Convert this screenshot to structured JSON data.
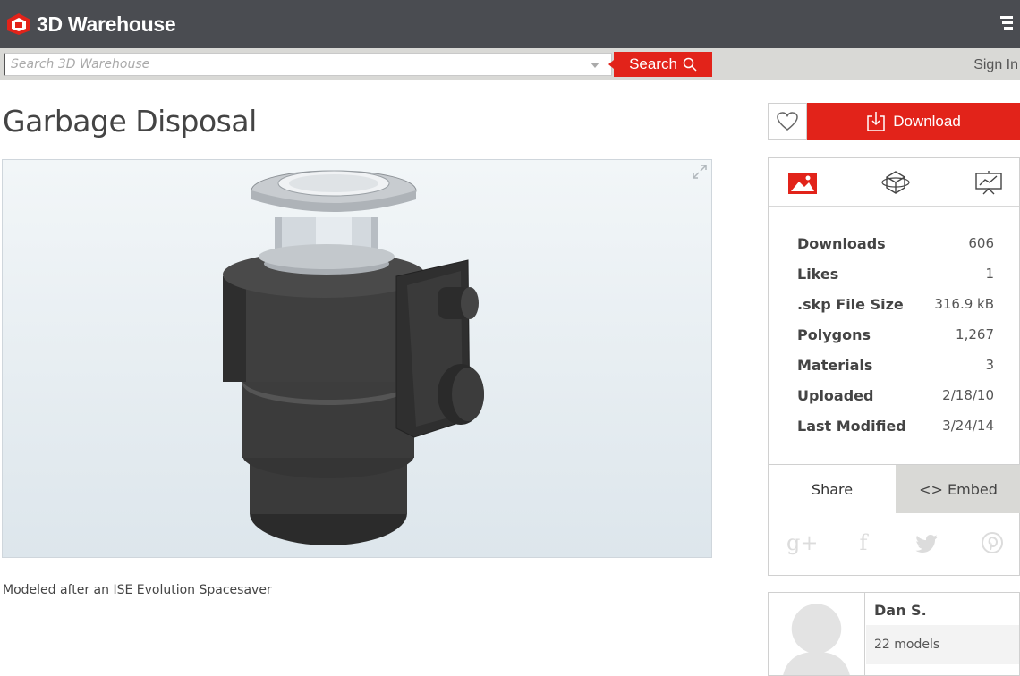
{
  "header": {
    "brand": "3D Warehouse",
    "logo_icon": "warehouse-logo-icon",
    "menu_icon": "menu-icon"
  },
  "search": {
    "placeholder": "Search 3D Warehouse",
    "button_label": "Search",
    "signin_label": "Sign In"
  },
  "model": {
    "title": "Garbage Disposal",
    "description": "Modeled after an ISE Evolution Spacesaver"
  },
  "actions": {
    "download_label": "Download"
  },
  "stats": [
    {
      "label": "Downloads",
      "value": "606"
    },
    {
      "label": "Likes",
      "value": "1"
    },
    {
      "label": ".skp File Size",
      "value": "316.9 kB"
    },
    {
      "label": "Polygons",
      "value": "1,267"
    },
    {
      "label": "Materials",
      "value": "3"
    },
    {
      "label": "Uploaded",
      "value": "2/18/10"
    },
    {
      "label": "Last Modified",
      "value": "3/24/14"
    }
  ],
  "share": {
    "share_tab": "Share",
    "embed_tab": "<> Embed"
  },
  "author": {
    "name": "Dan S.",
    "models": "22 models"
  },
  "colors": {
    "brand_red": "#e2231a",
    "header_bg": "#4a4c51"
  }
}
